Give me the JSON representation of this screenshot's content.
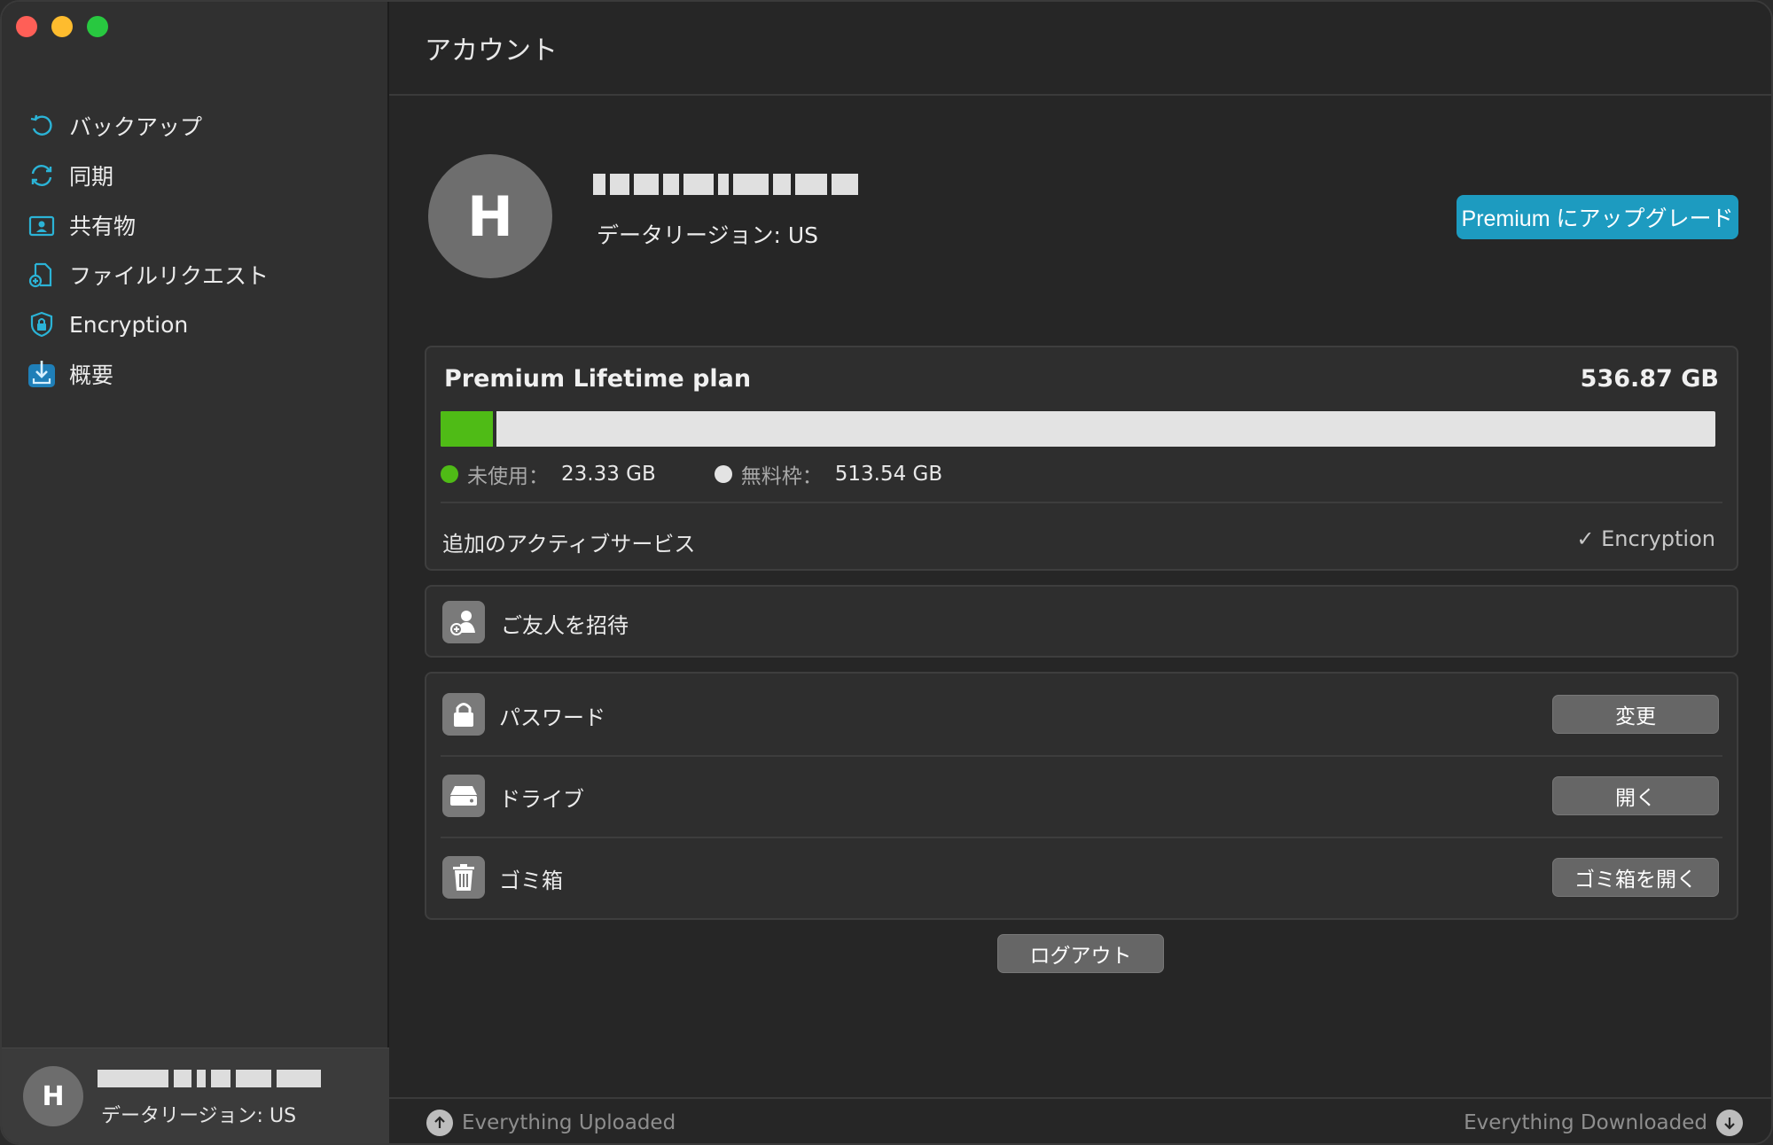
{
  "page": {
    "title": "アカウント"
  },
  "sidebar": {
    "items": [
      {
        "label": "バックアップ",
        "icon": "backup-icon"
      },
      {
        "label": "同期",
        "icon": "sync-icon"
      },
      {
        "label": "共有物",
        "icon": "shared-icon"
      },
      {
        "label": "ファイルリクエスト",
        "icon": "file-request-icon"
      },
      {
        "label": "Encryption",
        "icon": "lock-shield-icon"
      },
      {
        "label": "概要",
        "icon": "overview-icon"
      }
    ],
    "account": {
      "avatar_letter": "H",
      "region": "データリージョン: US"
    }
  },
  "profile": {
    "avatar_letter": "H",
    "region": "データリージョン: US",
    "upgrade_label": "Premium にアップグレード"
  },
  "plan": {
    "name": "Premium Lifetime plan",
    "total": "536.87 GB",
    "used_fraction": 0.0435,
    "used_label": "未使用：",
    "used_value": "23.33 GB",
    "free_label": "無料枠：",
    "free_value": "513.54 GB",
    "services_label": "追加のアクティブサービス",
    "services_value": "✓ Encryption"
  },
  "invite": {
    "label": "ご友人を招待"
  },
  "actions": {
    "password": {
      "label": "パスワード",
      "button": "変更"
    },
    "drive": {
      "label": "ドライブ",
      "button": "開く"
    },
    "trash": {
      "label": "ゴミ箱",
      "button": "ゴミ箱を開く"
    }
  },
  "logout_label": "ログアウト",
  "status": {
    "uploaded": "Everything Uploaded",
    "downloaded": "Everything Downloaded"
  },
  "colors": {
    "accent": "#1d9bc0",
    "used": "#4fbb16",
    "free": "#e3e3e3",
    "sidebar_icon": "#2bb3d6"
  }
}
